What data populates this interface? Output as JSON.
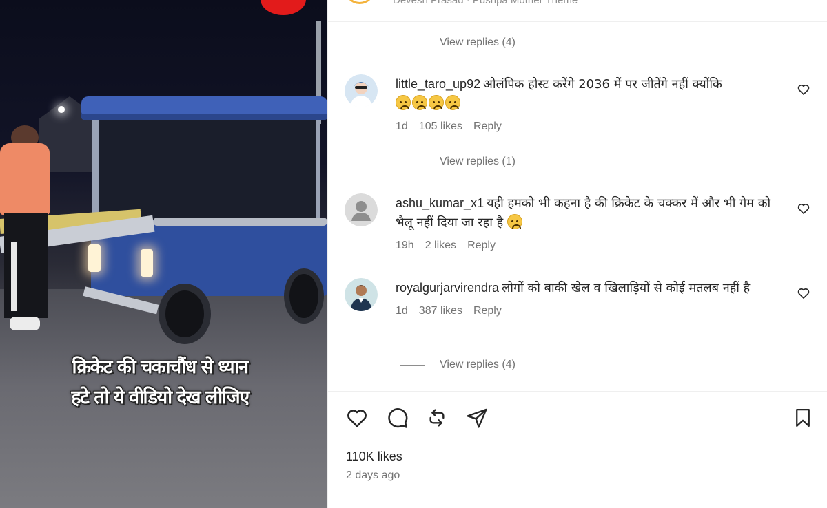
{
  "header": {
    "text": "Devesh Prasad · Pushpa Mother Theme"
  },
  "video": {
    "overlay_lines": [
      "क्रिकेट की चकाचौंध से ध्यान",
      "हटे तो ये वीडियो देख लीजिए"
    ]
  },
  "view_replies": [
    {
      "label": "View replies (4)"
    },
    {
      "label": "View replies (1)"
    },
    {
      "label": "View replies (4)"
    }
  ],
  "comments": [
    {
      "username": "little_taro_up92",
      "text": "ओलंपिक होस्ट करेंगे 2036 में पर जीतेंगे नहीं क्योंकि",
      "emoji_icons": [
        "sad-face-icon",
        "sad-face-icon",
        "sad-face-icon",
        "sad-face-icon"
      ],
      "age": "1d",
      "likes": "105 likes",
      "reply": "Reply"
    },
    {
      "username": "ashu_kumar_x1",
      "text": "यही हमको भी कहना है की क्रिकेट के चक्कर में और भी गेम को भैलू नहीं दिया जा रहा है",
      "emoji_icons": [
        "sad-face-icon"
      ],
      "age": "19h",
      "likes": "2 likes",
      "reply": "Reply"
    },
    {
      "username": "royalgurjarvirendra",
      "text": "लोगों को बाकी खेल व खिलाड़ियों से कोई मतलब नहीं है",
      "emoji_icons": [],
      "age": "1d",
      "likes": "387 likes",
      "reply": "Reply"
    }
  ],
  "actions": {
    "icons": [
      "heart-icon",
      "comment-icon",
      "repost-icon",
      "share-icon",
      "bookmark-icon"
    ]
  },
  "post": {
    "likes": "110K likes",
    "posted": "2 days ago"
  },
  "colors": {
    "text_primary": "#262626",
    "text_secondary": "#737373",
    "divider": "#efefef",
    "emoji_yellow": "#f6c744"
  }
}
